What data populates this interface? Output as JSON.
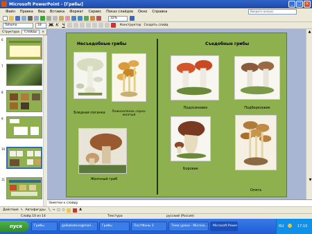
{
  "window": {
    "title": "Microsoft PowerPoint - [Грибы]"
  },
  "menu": {
    "items": [
      "Файл",
      "Правка",
      "Вид",
      "Вставка",
      "Формат",
      "Сервис",
      "Показ слайдов",
      "Окно",
      "Справка"
    ],
    "help_placeholder": "Введите вопрос"
  },
  "toolbar": {
    "zoom": "32%",
    "font": "Tahoma",
    "size": "18",
    "designer_label": "Конструктор",
    "new_slide_label": "Создать слайд"
  },
  "panel": {
    "tabs": [
      "Структура",
      "Слайды"
    ],
    "slide_numbers": [
      "6",
      "7",
      "8",
      "9",
      "10",
      "11"
    ]
  },
  "slide": {
    "left_heading": "Несъедобные грибы",
    "right_heading": "Съедобные грибы",
    "captions": {
      "poganka": "Бледная поганка",
      "lozhnye": "Ложноопенок серно-желтый",
      "zhelchny": "Желчный гриб",
      "podosinovik": "Подосиновик",
      "podberezovik": "Подберезовик",
      "borovik": "Боровик",
      "opyata": "Опята"
    }
  },
  "notes": {
    "placeholder": "Заметки к слайду"
  },
  "drawbar": {
    "actions_label": "Действия",
    "autoshapes_label": "Автофигуры"
  },
  "status": {
    "slide": "Слайд 10 из 14",
    "design": "Текстура",
    "language": "русский (Россия)"
  },
  "taskbar": {
    "start": "пуск",
    "tasks": [
      "Грибы",
      "galkabatova@mail...",
      "Грибы",
      "ПостФаны 3",
      "Тема урока - Microso...",
      "Microsoft PowerPoint..."
    ],
    "lang": "RU",
    "time": "17:15"
  }
}
